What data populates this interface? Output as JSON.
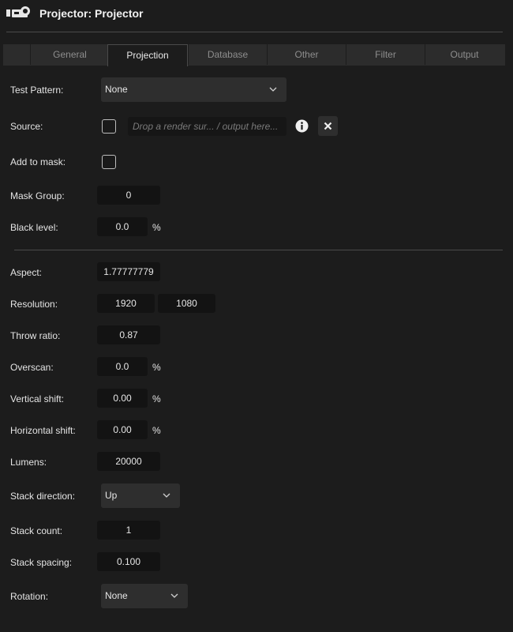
{
  "window": {
    "title": "Projector: Projector"
  },
  "tabs": [
    {
      "label": "General"
    },
    {
      "label": "Projection"
    },
    {
      "label": "Database"
    },
    {
      "label": "Other"
    },
    {
      "label": "Filter"
    },
    {
      "label": "Output"
    }
  ],
  "active_tab": "Projection",
  "fields": {
    "test_pattern": {
      "label": "Test Pattern:",
      "value": "None"
    },
    "source": {
      "label": "Source:",
      "placeholder": "Drop a render sur... / output here..."
    },
    "add_to_mask": {
      "label": "Add to mask:",
      "checked": false
    },
    "mask_group": {
      "label": "Mask Group:",
      "value": "0"
    },
    "black_level": {
      "label": "Black level:",
      "value": "0.0",
      "unit": "%"
    },
    "aspect": {
      "label": "Aspect:",
      "value": "1.77777779"
    },
    "resolution": {
      "label": "Resolution:",
      "width": "1920",
      "height": "1080"
    },
    "throw_ratio": {
      "label": "Throw ratio:",
      "value": "0.87"
    },
    "overscan": {
      "label": "Overscan:",
      "value": "0.0",
      "unit": "%"
    },
    "vertical_shift": {
      "label": "Vertical shift:",
      "value": "0.00",
      "unit": "%"
    },
    "horizontal_shift": {
      "label": "Horizontal shift:",
      "value": "0.00",
      "unit": "%"
    },
    "lumens": {
      "label": "Lumens:",
      "value": "20000"
    },
    "stack_direction": {
      "label": "Stack direction:",
      "value": "Up"
    },
    "stack_count": {
      "label": "Stack count:",
      "value": "1"
    },
    "stack_spacing": {
      "label": "Stack spacing:",
      "value": "0.100"
    },
    "rotation": {
      "label": "Rotation:",
      "value": "None"
    }
  },
  "icons": {
    "header": "projector-icon",
    "info": "info-icon",
    "clear": "close-icon",
    "dropdown": "chevron-down-icon"
  },
  "colors": {
    "background": "#1c1c1c",
    "field_background": "#131313",
    "select_background": "#2e2e2e",
    "tab_bar": "#2c2c2c",
    "text": "#e4e4e4",
    "muted_text": "#8d8d8d"
  }
}
